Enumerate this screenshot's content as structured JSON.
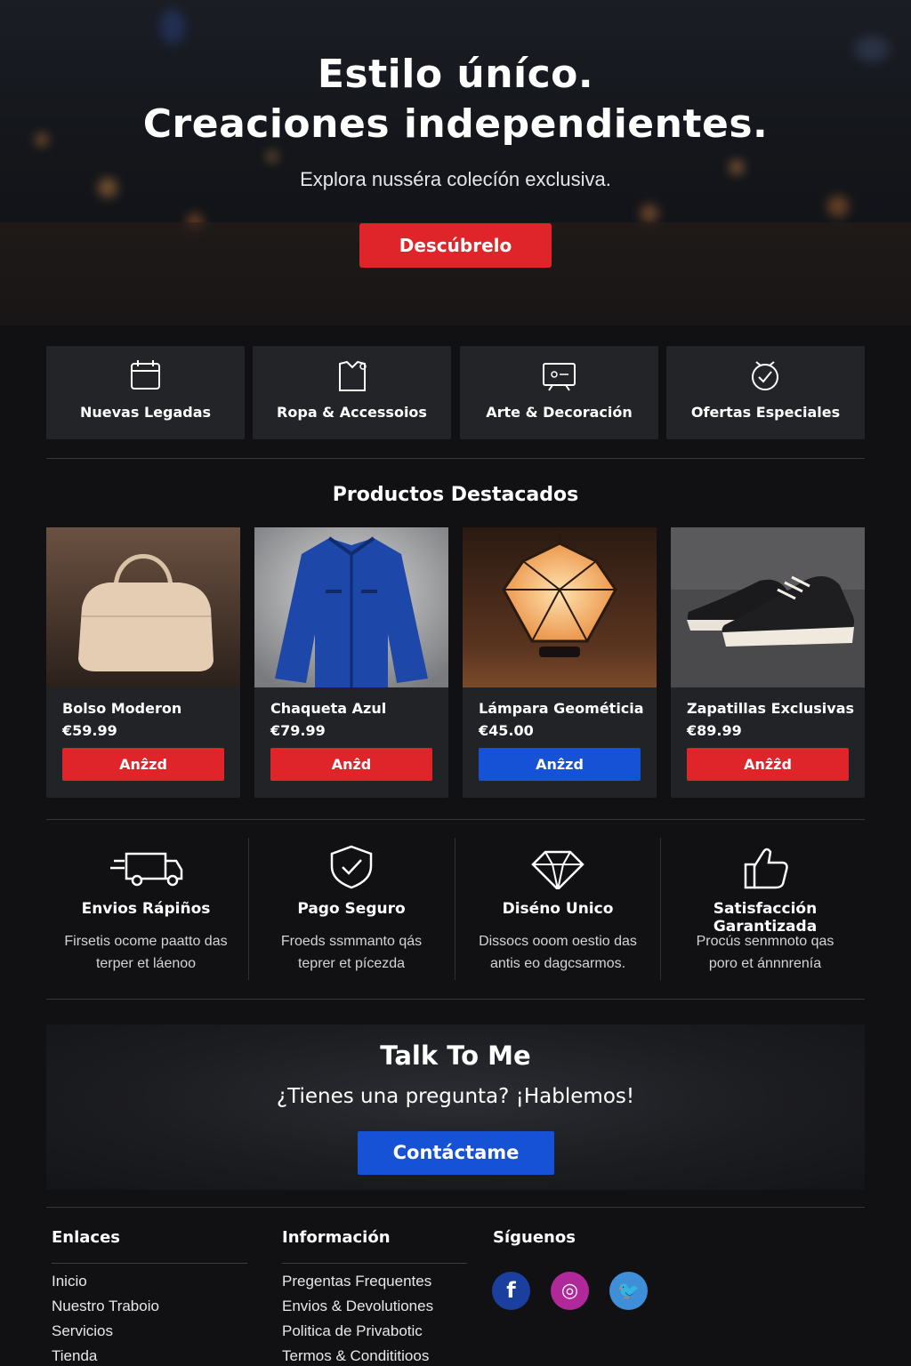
{
  "hero": {
    "title_line1": "Estilo úníco.",
    "title_line2": "Creaciones independientes.",
    "subtitle": "Explora nusséra colecíón exclusiva.",
    "cta_label": "Descúbrelo"
  },
  "categories": [
    {
      "label": "Nuevas Legadas",
      "icon": "calendar-icon"
    },
    {
      "label": "Ropa & Accessoios",
      "icon": "shirt-icon"
    },
    {
      "label": "Arte & Decoración",
      "icon": "art-frame-icon"
    },
    {
      "label": "Ofertas Especiales",
      "icon": "badge-tag-icon"
    }
  ],
  "featured": {
    "title": "Productos Destacados",
    "products": [
      {
        "name": "Bolso Moderon",
        "price": "€59.99",
        "button": "Anẑzd",
        "button_color": "#e0252a"
      },
      {
        "name": "Chaqueta Azul",
        "price": "€79.99",
        "button": "Anẑd",
        "button_color": "#e0252a"
      },
      {
        "name": "Lámpara Geométicia",
        "price": "€45.00",
        "button": "Anẑzd",
        "button_color": "#1652d6"
      },
      {
        "name": "Zapatillas Exclusivas",
        "price": "€89.99",
        "button": "Anẑẑd",
        "button_color": "#e0252a"
      }
    ]
  },
  "features": [
    {
      "title": "Envios Rápiños",
      "line1": "Firsetis ocome paatto das",
      "line2": "terper et láenoo",
      "icon": "truck-icon"
    },
    {
      "title": "Pago Seguro",
      "line1": "Froeds ssmmanto qás",
      "line2": "teprer et pícezda",
      "icon": "shield-check-icon"
    },
    {
      "title": "Diséno Unico",
      "line1": "Dissocs ooom oestio das",
      "line2": "antis eo dagcsarmos.",
      "icon": "diamond-icon"
    },
    {
      "title": "Satisfacción Garantizada",
      "line1": "Procús senmnoto qas",
      "line2": "poro et ánnnrenía",
      "icon": "thumbs-up-icon"
    }
  ],
  "talk": {
    "title": "Talk To Me",
    "subtitle": "¿Tienes una pregunta? ¡Hablemos!",
    "button": "Contáctame"
  },
  "footer": {
    "links_title": "Enlaces",
    "links": [
      "Inicio",
      "Nuestro Traboio",
      "Servicios",
      "Tienda"
    ],
    "info_title": "Información",
    "info": [
      "Pregentas Frequentes",
      "Envios & Devolutiones",
      "Politica de Privabotic",
      "Termos & Condititioos"
    ],
    "social_title": "Síguenos",
    "social": [
      {
        "label": "f",
        "icon": "facebook-icon",
        "color": "#1b3f9e"
      },
      {
        "label": "◎",
        "icon": "instagram-icon",
        "color": "#b0289a"
      },
      {
        "label": "🐦",
        "icon": "twitter-icon",
        "color": "#3f8fd8"
      }
    ]
  }
}
